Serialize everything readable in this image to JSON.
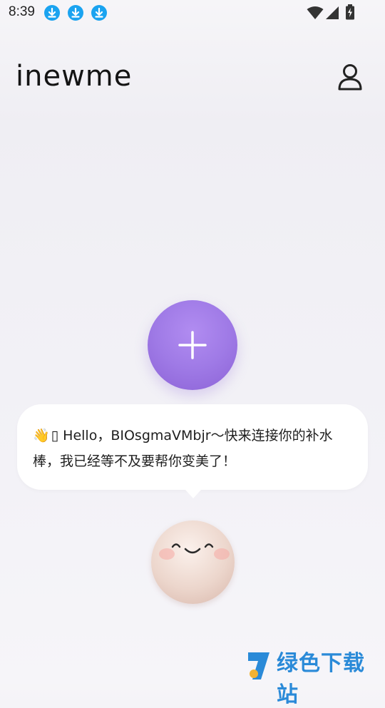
{
  "status_bar": {
    "time": "8:39",
    "download_icon_count": 3,
    "download_icon_color": "#1aa3f0",
    "icons": [
      "wifi-icon",
      "cell-signal-icon",
      "battery-charging-icon"
    ]
  },
  "header": {
    "logo_text": "inewme",
    "profile_icon": "user-icon"
  },
  "main": {
    "add_button_icon": "plus-icon",
    "add_button_color": "#9f7ae6",
    "bubble": {
      "emoji": "👋",
      "glyph": "▯",
      "message": " Hello，BIOsgmaVMbjr～快来连接你的补水棒，我已经等不及要帮你变美了！"
    },
    "mascot_icon": "smiling-face-mascot"
  },
  "watermark": {
    "text": "绿色下载站"
  }
}
